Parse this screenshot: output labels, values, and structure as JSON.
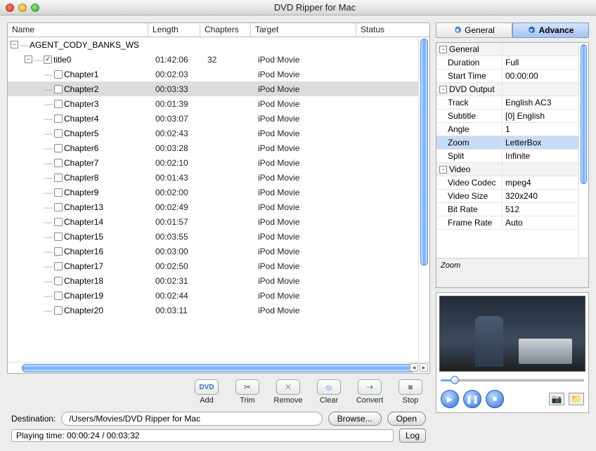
{
  "window": {
    "title": "DVD Ripper for Mac"
  },
  "table": {
    "columns": {
      "name": "Name",
      "length": "Length",
      "chapters": "Chapters",
      "target": "Target",
      "status": "Status"
    },
    "disc": "AGENT_CODY_BANKS_WS",
    "title_row": {
      "name": "title0",
      "length": "01:42:06",
      "chapters": "32",
      "target": "iPod Movie",
      "checked": true
    },
    "rows": [
      {
        "name": "Chapter1",
        "length": "00:02:03",
        "target": "iPod Movie",
        "sel": false
      },
      {
        "name": "Chapter2",
        "length": "00:03:33",
        "target": "iPod Movie",
        "sel": true
      },
      {
        "name": "Chapter3",
        "length": "00:01:39",
        "target": "iPod Movie",
        "sel": false
      },
      {
        "name": "Chapter4",
        "length": "00:03:07",
        "target": "iPod Movie",
        "sel": false
      },
      {
        "name": "Chapter5",
        "length": "00:02:43",
        "target": "iPod Movie",
        "sel": false
      },
      {
        "name": "Chapter6",
        "length": "00:03:28",
        "target": "iPod Movie",
        "sel": false
      },
      {
        "name": "Chapter7",
        "length": "00:02:10",
        "target": "iPod Movie",
        "sel": false
      },
      {
        "name": "Chapter8",
        "length": "00:01:43",
        "target": "iPod Movie",
        "sel": false
      },
      {
        "name": "Chapter9",
        "length": "00:02:00",
        "target": "iPod Movie",
        "sel": false
      },
      {
        "name": "Chapter13",
        "length": "00:02:49",
        "target": "iPod Movie",
        "sel": false
      },
      {
        "name": "Chapter14",
        "length": "00:01:57",
        "target": "iPod Movie",
        "sel": false
      },
      {
        "name": "Chapter15",
        "length": "00:03:55",
        "target": "iPod Movie",
        "sel": false
      },
      {
        "name": "Chapter16",
        "length": "00:03:00",
        "target": "iPod Movie",
        "sel": false
      },
      {
        "name": "Chapter17",
        "length": "00:02:50",
        "target": "iPod Movie",
        "sel": false
      },
      {
        "name": "Chapter18",
        "length": "00:02:31",
        "target": "iPod Movie",
        "sel": false
      },
      {
        "name": "Chapter19",
        "length": "00:02:44",
        "target": "iPod Movie",
        "sel": false
      },
      {
        "name": "Chapter20",
        "length": "00:03:11",
        "target": "iPod Movie",
        "sel": false
      }
    ]
  },
  "toolbar": {
    "add": "Add",
    "trim": "Trim",
    "remove": "Remove",
    "clear": "Clear",
    "convert": "Convert",
    "stop": "Stop",
    "add_glyph": "DVD",
    "trim_glyph": "✂",
    "remove_glyph": "✕",
    "clear_glyph": "⦸",
    "convert_glyph": "⇢",
    "stop_glyph": "■"
  },
  "destination": {
    "label": "Destination:",
    "value": "/Users/Movies/DVD Ripper for Mac",
    "browse": "Browse...",
    "open": "Open"
  },
  "status": {
    "text": "Playing time: 00:00:24 / 00:03:32",
    "log": "Log"
  },
  "tabs": {
    "general": "General",
    "advance": "Advance"
  },
  "props": {
    "groups": [
      {
        "name": "General",
        "rows": [
          {
            "k": "Duration",
            "v": "Full"
          },
          {
            "k": "Start Time",
            "v": "00:00:00"
          }
        ]
      },
      {
        "name": "DVD Output",
        "rows": [
          {
            "k": "Track",
            "v": "English AC3"
          },
          {
            "k": "Subtitle",
            "v": "[0] English"
          },
          {
            "k": "Angle",
            "v": "1"
          },
          {
            "k": "Zoom",
            "v": "LetterBox",
            "sel": true
          },
          {
            "k": "Split",
            "v": "Infinite"
          }
        ]
      },
      {
        "name": "Video",
        "rows": [
          {
            "k": "Video Codec",
            "v": "mpeg4"
          },
          {
            "k": "Video Size",
            "v": "320x240"
          },
          {
            "k": "Bit Rate",
            "v": "512"
          },
          {
            "k": "Frame Rate",
            "v": "Auto"
          }
        ]
      }
    ],
    "desc": "Zoom"
  },
  "player": {
    "play": "▶",
    "pause": "❚❚",
    "stop": "■"
  }
}
